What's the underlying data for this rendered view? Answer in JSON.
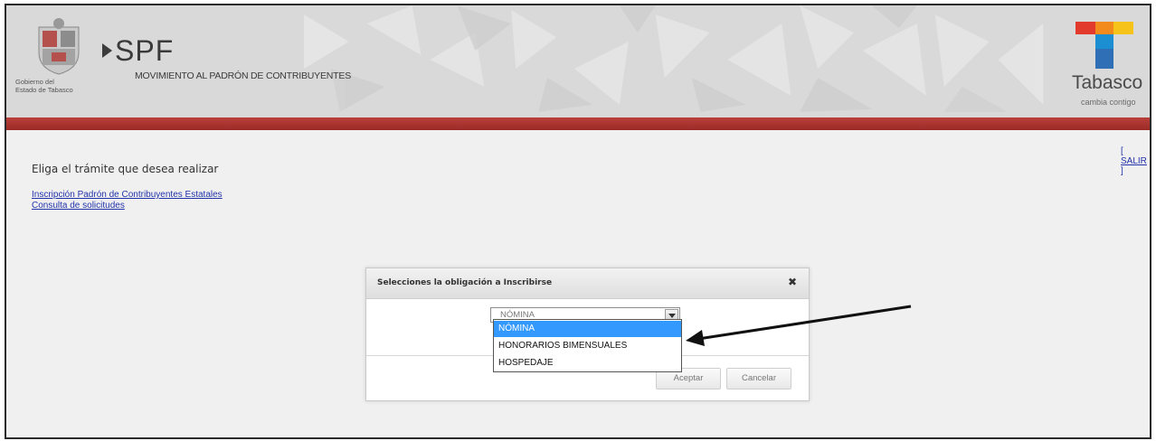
{
  "header": {
    "gov_logo_text": [
      "Gobierno del",
      "Estado de Tabasco"
    ],
    "system_name": "SPF",
    "system_subtitle": "MOVIMIENTO AL PADRÓN DE CONTRIBUYENTES",
    "brand_name": "Tabasco",
    "brand_slogan": "cambia contigo",
    "bar_color": "#a8332f"
  },
  "main": {
    "logout_link": "[ SALIR ]",
    "heading": "Eliga el trámite que desea realizar",
    "links": [
      "Inscripción Padrón de Contribuyentes Estatales",
      "Consulta de solicitudes"
    ]
  },
  "dialog": {
    "title": "Selecciones la obligación a Inscribirse",
    "close_icon": "close-icon",
    "select": {
      "current_value": "NÓMINA",
      "options": [
        "NÓMINA",
        "HONORARIOS BIMENSUALES",
        "HOSPEDAJE"
      ],
      "highlighted_option": "NÓMINA",
      "highlight_color": "#3399ff"
    },
    "accept_label": "Aceptar",
    "cancel_label": "Cancelar"
  },
  "annotation": {
    "icon": "pointer-arrow-icon"
  }
}
